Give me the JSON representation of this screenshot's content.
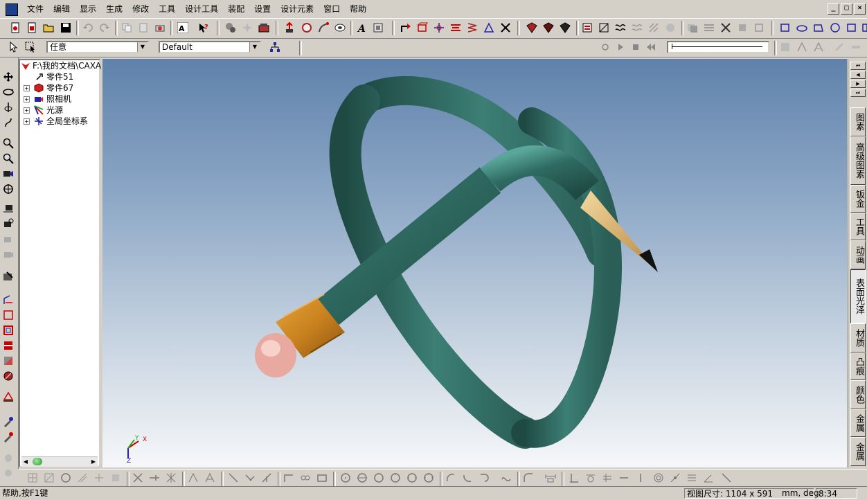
{
  "menu": {
    "items": [
      "文件",
      "编辑",
      "显示",
      "生成",
      "修改",
      "工具",
      "设计工具",
      "装配",
      "设置",
      "设计元素",
      "窗口",
      "帮助"
    ],
    "window_controls": [
      "_",
      "□",
      "×"
    ]
  },
  "toolbar2": {
    "filter_combo": "任意",
    "style_combo": "Default"
  },
  "tree": {
    "root_label": "F:\\我的文档\\CAXA",
    "items": [
      {
        "label": "零件51",
        "expandable": false
      },
      {
        "label": "零件67",
        "expandable": true
      },
      {
        "label": "照相机",
        "expandable": true
      },
      {
        "label": "光源",
        "expandable": true
      },
      {
        "label": "全局坐标系",
        "expandable": true
      }
    ]
  },
  "axes": {
    "x": "X",
    "y": "Y",
    "z": "Z"
  },
  "right_tabs": {
    "nav": [
      "⏮",
      "◀",
      "▶",
      "⏭"
    ],
    "items": [
      {
        "label": "图素",
        "active": false
      },
      {
        "label": "高级图素",
        "active": false
      },
      {
        "label": "钣金",
        "active": false
      },
      {
        "label": "工具",
        "active": false
      },
      {
        "label": "动画",
        "active": false
      },
      {
        "label": "表面光泽",
        "active": true
      },
      {
        "label": "材质",
        "active": false
      },
      {
        "label": "凸痕",
        "active": false
      },
      {
        "label": "颜色",
        "active": false
      },
      {
        "label": "金属",
        "active": false
      },
      {
        "label": "金属",
        "active": false
      }
    ]
  },
  "status": {
    "help": "帮助,按F1键",
    "view_size": "视图尺寸: 1104 x 591",
    "units": "mm, deg",
    "time": "8:34"
  },
  "colors": {
    "pencil_body": "#2f6b62",
    "ferrule": "#c8811e",
    "eraser": "#e8a9a0",
    "wood": "#d4a85a"
  }
}
